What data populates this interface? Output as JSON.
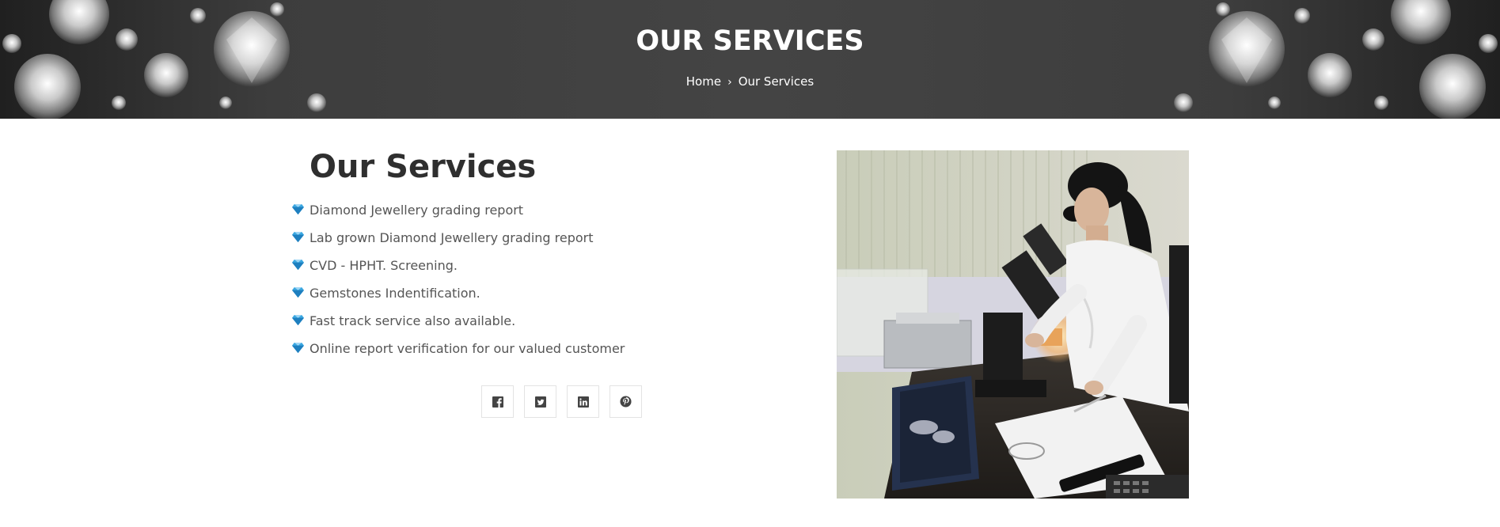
{
  "hero": {
    "title": "OUR SERVICES",
    "breadcrumb": {
      "home": "Home",
      "separator": "›",
      "current": "Our Services"
    }
  },
  "section": {
    "title": "Our Services",
    "services": [
      "Diamond Jewellery grading report",
      "Lab grown Diamond Jewellery grading report",
      "CVD - HPHT. Screening.",
      "Gemstones Indentification.",
      "Fast track service also available.",
      "Online report verification for our valued customer"
    ]
  },
  "social": [
    {
      "icon": "facebook-icon"
    },
    {
      "icon": "twitter-icon"
    },
    {
      "icon": "linkedin-icon"
    },
    {
      "icon": "pinterest-icon"
    }
  ],
  "colors": {
    "hero_bg": "#444444",
    "title_text": "#2f2f2f",
    "list_text": "#555555",
    "diamond_accent": "#3aa7e0"
  }
}
